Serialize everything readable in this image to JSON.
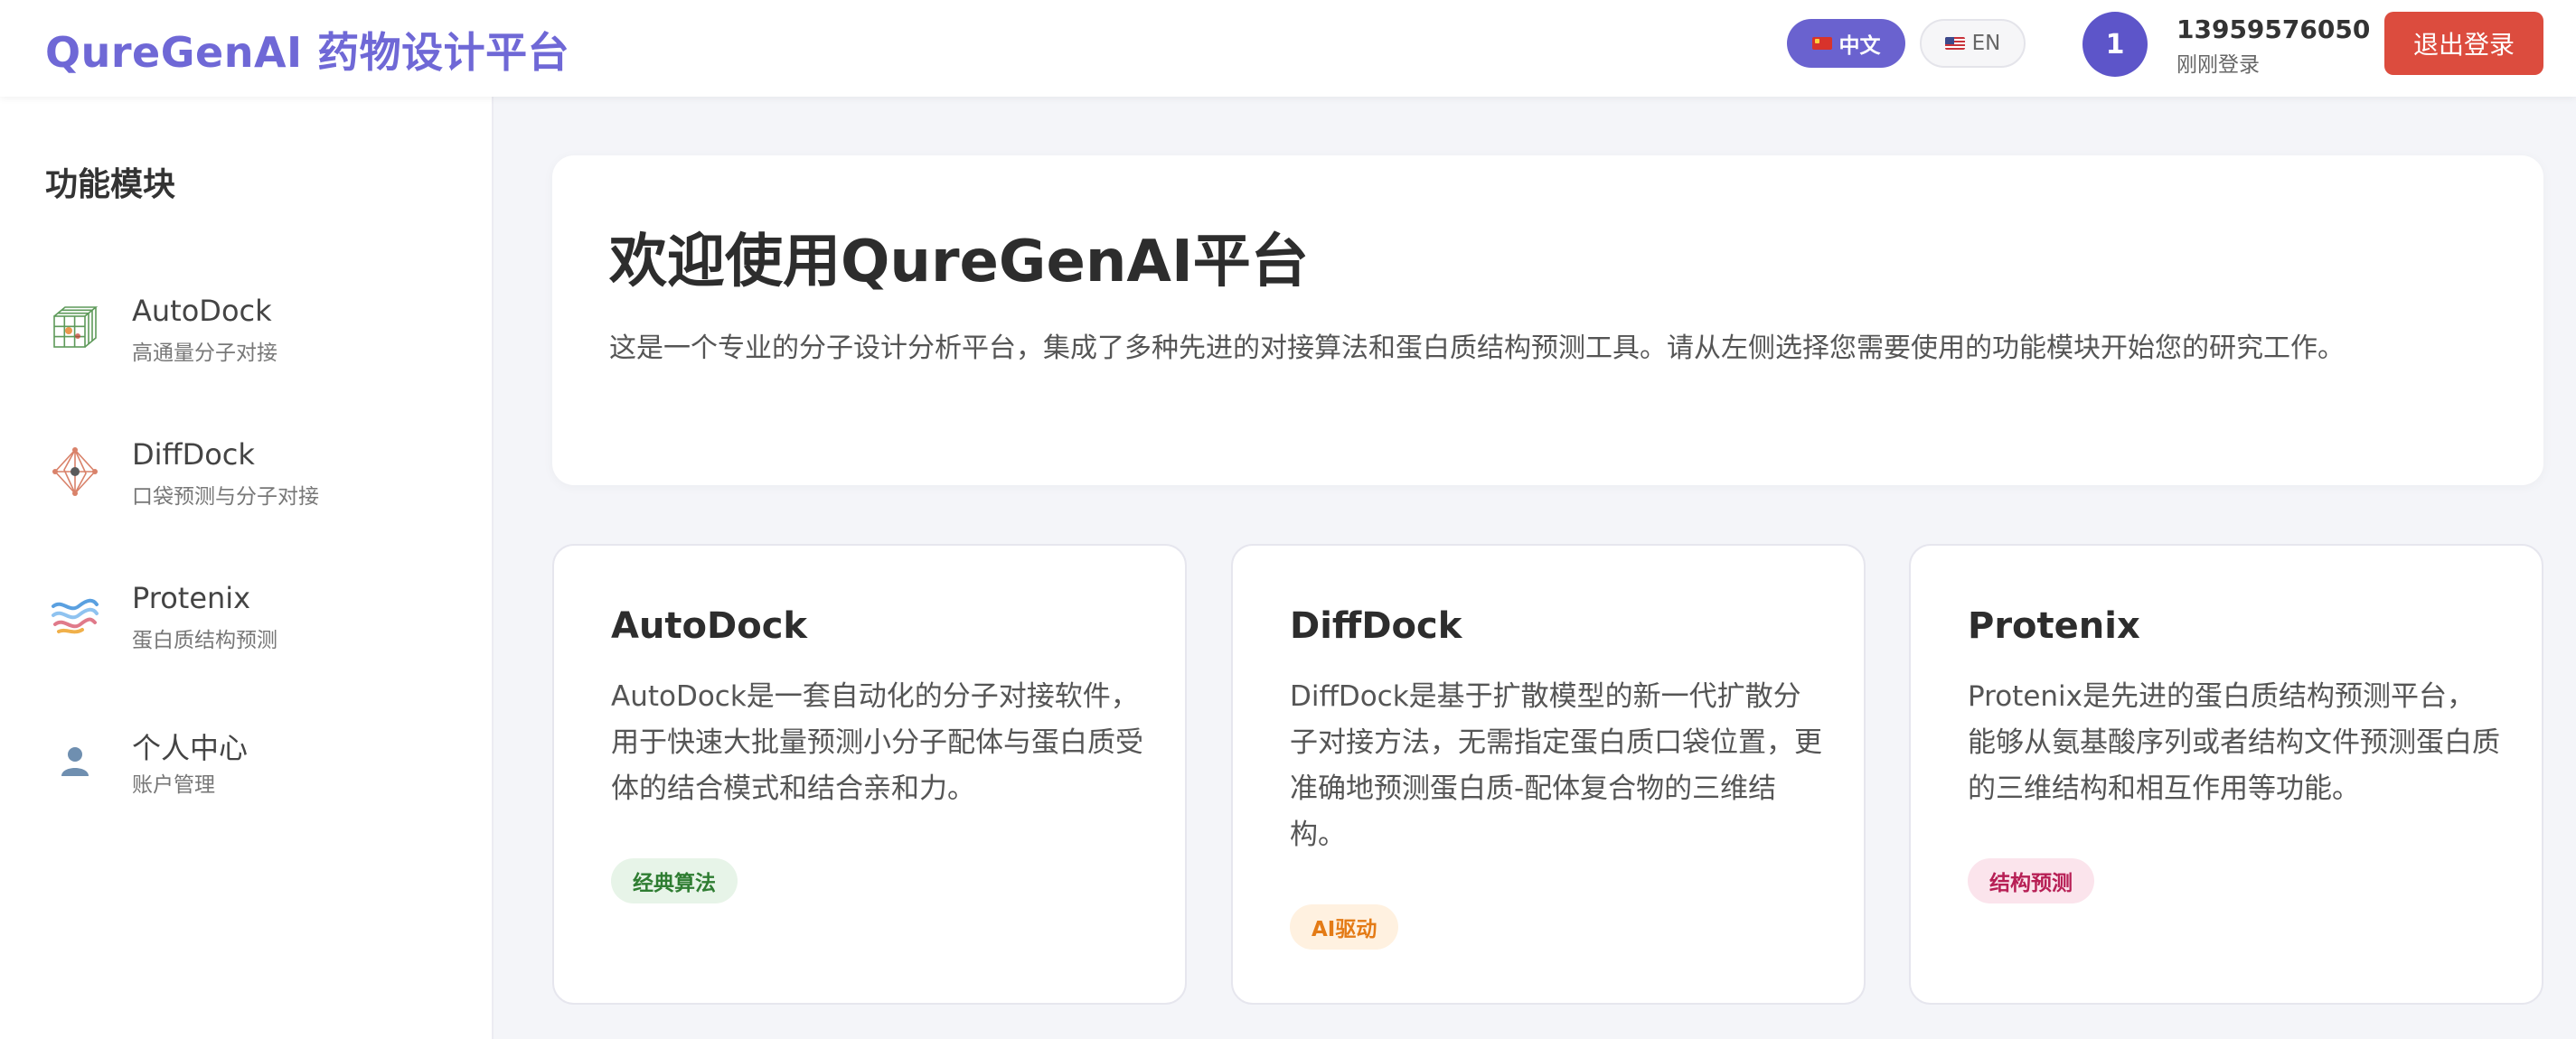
{
  "header": {
    "brand": "QureGenAI 药物设计平台",
    "lang_zh": "中文",
    "lang_en": "EN",
    "avatar_initial": "1",
    "user_phone": "13959576050",
    "user_status": "刚刚登录",
    "logout_label": "退出登录"
  },
  "sidebar": {
    "title": "功能模块",
    "items": [
      {
        "label": "AutoDock",
        "sub": "高通量分子对接",
        "icon": "grid-cube-icon"
      },
      {
        "label": "DiffDock",
        "sub": "口袋预测与分子对接",
        "icon": "molecule-icon"
      },
      {
        "label": "Protenix",
        "sub": "蛋白质结构预测",
        "icon": "protein-ribbon-icon"
      },
      {
        "label": "个人中心",
        "sub": "账户管理",
        "icon": "user-icon"
      }
    ]
  },
  "welcome": {
    "title": "欢迎使用QureGenAI平台",
    "description": "这是一个专业的分子设计分析平台，集成了多种先进的对接算法和蛋白质结构预测工具。请从左侧选择您需要使用的功能模块开始您的研究工作。"
  },
  "cards": [
    {
      "title": "AutoDock",
      "description": "AutoDock是一套自动化的分子对接软件，用于快速大批量预测小分子配体与蛋白质受体的结合模式和结合亲和力。",
      "badge": "经典算法"
    },
    {
      "title": "DiffDock",
      "description": "DiffDock是基于扩散模型的新一代扩散分子对接方法，无需指定蛋白质口袋位置，更准确地预测蛋白质-配体复合物的三维结构。",
      "badge": "AI驱动"
    },
    {
      "title": "Protenix",
      "description": "Protenix是先进的蛋白质结构预测平台，能够从氨基酸序列或者结构文件预测蛋白质的三维结构和相互作用等功能。",
      "badge": "结构预测"
    }
  ],
  "colors": {
    "brand": "#6f68d6",
    "accent": "#6a62cf",
    "logout": "#dc4c3e",
    "badge_green": "#2f7d32",
    "badge_orange": "#e47b16",
    "badge_pink": "#b71f55"
  }
}
